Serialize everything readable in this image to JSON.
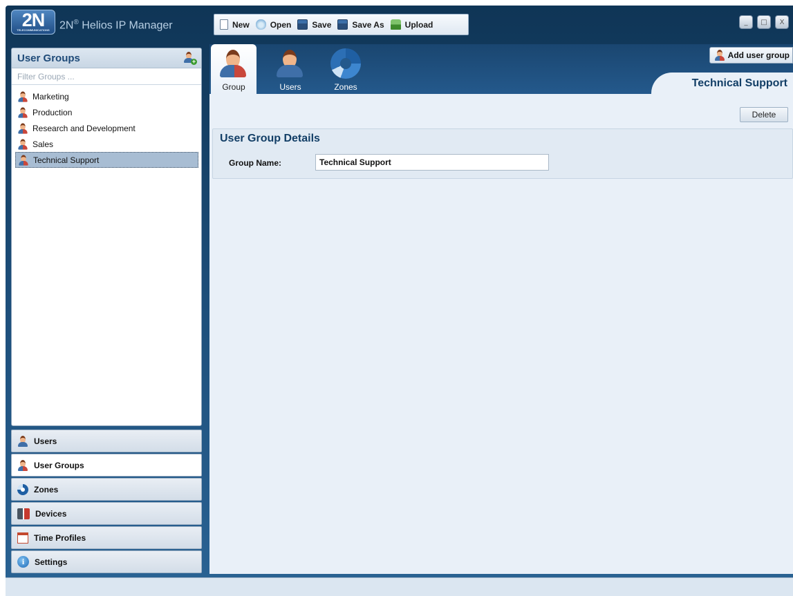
{
  "app": {
    "logo_mark": "2N",
    "logo_sub": "TELECOMMUNICATIONS",
    "logo_title_prefix": "2N",
    "logo_title_suffix": " Helios IP Manager"
  },
  "toolbar": {
    "new_label": "New",
    "open_label": "Open",
    "save_label": "Save",
    "saveas_label": "Save As",
    "upload_label": "Upload"
  },
  "window_controls": {
    "minimize": "_",
    "maximize": "□",
    "close": "X"
  },
  "sidebar": {
    "title": "User Groups",
    "filter_placeholder": "Filter Groups ...",
    "groups": [
      {
        "label": "Marketing",
        "selected": false
      },
      {
        "label": "Production",
        "selected": false
      },
      {
        "label": "Research and Development",
        "selected": false
      },
      {
        "label": "Sales",
        "selected": false
      },
      {
        "label": "Technical Support",
        "selected": true
      }
    ],
    "nav": [
      {
        "label": "Users",
        "icon": "user-icon",
        "active": false
      },
      {
        "label": "User Groups",
        "icon": "user-group-icon",
        "active": true
      },
      {
        "label": "Zones",
        "icon": "zones-icon",
        "active": false
      },
      {
        "label": "Devices",
        "icon": "devices-icon",
        "active": false
      },
      {
        "label": "Time Profiles",
        "icon": "calendar-icon",
        "active": false
      },
      {
        "label": "Settings",
        "icon": "info-icon",
        "active": false
      }
    ]
  },
  "main": {
    "tabs": [
      {
        "label": "Group",
        "active": true
      },
      {
        "label": "Users",
        "active": false
      },
      {
        "label": "Zones",
        "active": false
      }
    ],
    "add_button_label": "Add user group",
    "page_title": "Technical Support",
    "delete_label": "Delete",
    "details": {
      "title": "User Group Details",
      "group_name_label": "Group Name:",
      "group_name_value": "Technical Support"
    }
  },
  "colors": {
    "accent": "#1e4a78",
    "header_bg": "#0f3556",
    "panel_bg": "#e9f0f8",
    "selection": "#a8bdd3"
  }
}
